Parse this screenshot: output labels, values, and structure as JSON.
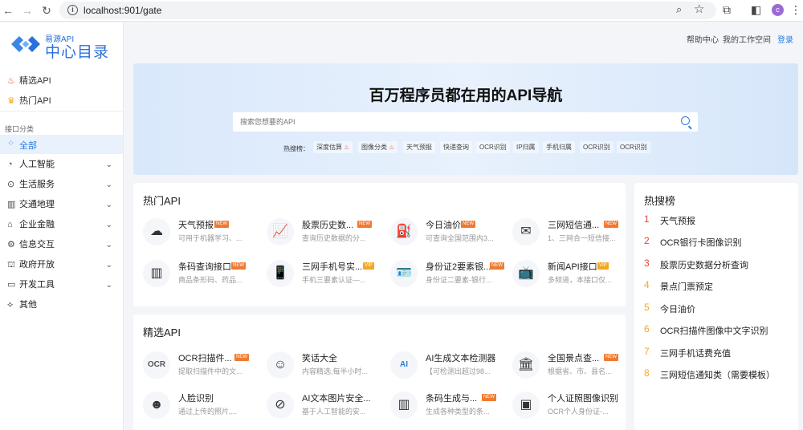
{
  "browser": {
    "url": "localhost:901/gate",
    "avatar": "c"
  },
  "logo": {
    "small": "易源API",
    "big": "中心目录"
  },
  "sidebar": {
    "top_items": [
      {
        "label": "精选API",
        "icon": "fire-icon"
      },
      {
        "label": "热门API",
        "icon": "crown-icon"
      }
    ],
    "category_label": "接口分类",
    "all_label": "全部",
    "items": [
      {
        "label": "人工智能",
        "icon": "brain-icon"
      },
      {
        "label": "生活服务",
        "icon": "life-icon"
      },
      {
        "label": "交通地理",
        "icon": "map-icon"
      },
      {
        "label": "企业金融",
        "icon": "finance-icon"
      },
      {
        "label": "信息交互",
        "icon": "gear-icon"
      },
      {
        "label": "政府开放",
        "icon": "gov-icon"
      },
      {
        "label": "开发工具",
        "icon": "dev-icon"
      },
      {
        "label": "其他",
        "icon": "other-icon"
      }
    ]
  },
  "header": {
    "help": "帮助中心",
    "workspace": "我的工作空间",
    "login": "登录"
  },
  "banner": {
    "title": "百万程序员都在用的API导航",
    "search_placeholder": "搜索您想要的API",
    "hot_label": "热搜榜：",
    "hot_tags": [
      "深度估算",
      "图像分类",
      "天气预报",
      "快递查询",
      "OCR识别",
      "IP归属",
      "手机归属",
      "OCR识别",
      "OCR识别"
    ]
  },
  "hot_api": {
    "title": "热门API",
    "cards": [
      {
        "name": "天气预报",
        "desc": "可用于机器学习、...",
        "badge": "NEW",
        "icon": "weather-icon"
      },
      {
        "name": "股票历史数...",
        "desc": "查询历史数据的分...",
        "badge": "NEW",
        "icon": "stock-icon"
      },
      {
        "name": "今日油价",
        "desc": "可查询全国范围内3...",
        "badge": "NEW",
        "icon": "oil-icon"
      },
      {
        "name": "三网短信通...",
        "desc": "1、三网合一短信接...",
        "badge": "NEW",
        "icon": "sms-icon"
      },
      {
        "name": "条码查询接口",
        "desc": "商品条形码、药品...",
        "badge": "NEW",
        "icon": "barcode-icon"
      },
      {
        "name": "三网手机号实...",
        "desc": "手机三要素认证—...",
        "badge": "VIP",
        "icon": "phone-icon"
      },
      {
        "name": "身份证2要素银...",
        "desc": "身份证二要素-银行...",
        "badge": "NEW",
        "icon": "idcard-icon"
      },
      {
        "name": "新闻API接口",
        "desc": "多频道，本接口仅...",
        "badge": "VIP",
        "icon": "news-icon"
      }
    ]
  },
  "featured_api": {
    "title": "精选API",
    "cards": [
      {
        "name": "OCR扫描件...",
        "desc": "提取扫描件中的文...",
        "badge": "NEW",
        "icon": "ocr-icon"
      },
      {
        "name": "笑话大全",
        "desc": "内容精选,每半小时...",
        "badge": "",
        "icon": "laugh-icon"
      },
      {
        "name": "AI生成文本检测器",
        "desc": "【可检测出超过98...",
        "badge": "",
        "icon": "ai-doc-icon"
      },
      {
        "name": "全国景点查...",
        "desc": "根据省、市、县名...",
        "badge": "NEW",
        "icon": "scenic-icon"
      },
      {
        "name": "人脸识别",
        "desc": "通过上传的照片,...",
        "badge": "",
        "icon": "face-icon"
      },
      {
        "name": "AI文本图片安全...",
        "desc": "基于人工智能的安...",
        "badge": "",
        "icon": "forbid-icon"
      },
      {
        "name": "条码生成与...",
        "desc": "生成各种类型的条...",
        "badge": "NEW",
        "icon": "barcode-gen-icon"
      },
      {
        "name": "个人证照图像识别",
        "desc": "OCR个人身份证-...",
        "badge": "",
        "icon": "cert-icon"
      }
    ]
  },
  "hot_search": {
    "title": "热搜榜",
    "items": [
      {
        "rank": "1",
        "label": "天气预报",
        "color": "#e8452e"
      },
      {
        "rank": "2",
        "label": "OCR银行卡图像识别",
        "color": "#e8452e"
      },
      {
        "rank": "3",
        "label": "股票历史数据分析查询",
        "color": "#e8452e"
      },
      {
        "rank": "4",
        "label": "景点门票预定",
        "color": "#f5a623"
      },
      {
        "rank": "5",
        "label": "今日油价",
        "color": "#f5a623"
      },
      {
        "rank": "6",
        "label": "OCR扫描件图像中文字识别",
        "color": "#f5a623"
      },
      {
        "rank": "7",
        "label": "三网手机话费充值",
        "color": "#f5a623"
      },
      {
        "rank": "8",
        "label": "三网短信通知类（需要模板）",
        "color": "#f5a623"
      }
    ]
  }
}
